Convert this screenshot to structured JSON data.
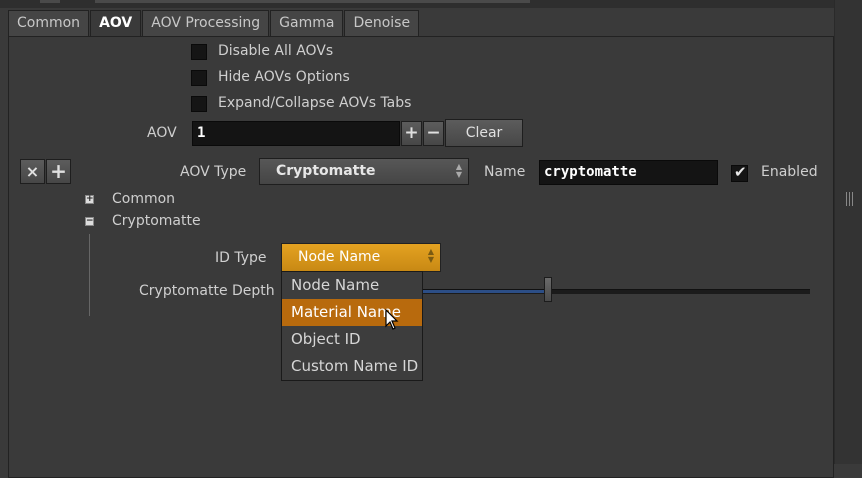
{
  "tabs": [
    "Common",
    "AOV",
    "AOV Processing",
    "Gamma",
    "Denoise"
  ],
  "active_tab": "AOV",
  "options": {
    "disable_all_aovs": "Disable All AOVs",
    "hide_aovs_options": "Hide AOVs Options",
    "expand_collapse": "Expand/Collapse AOVs Tabs"
  },
  "aov": {
    "label": "AOV",
    "count": "1",
    "plus": "+",
    "minus": "−",
    "clear": "Clear"
  },
  "entry": {
    "remove": "×",
    "add": "+",
    "type_label": "AOV Type",
    "type_value": "Cryptomatte",
    "name_label": "Name",
    "name_value": "cryptomatte",
    "enabled_label": "Enabled",
    "enabled": true
  },
  "tree": {
    "common": "Common",
    "cryptomatte": "Cryptomatte"
  },
  "id_type": {
    "label": "ID Type",
    "value": "Node Name",
    "options": [
      "Node Name",
      "Material Name",
      "Object ID",
      "Custom Name ID"
    ],
    "hovered_index": 1
  },
  "depth": {
    "label": "Cryptomatte Depth"
  },
  "colors": {
    "accent": "#b86a0d",
    "dropdown_open": "#d8981a",
    "slider_fill": "#2c4e86"
  }
}
